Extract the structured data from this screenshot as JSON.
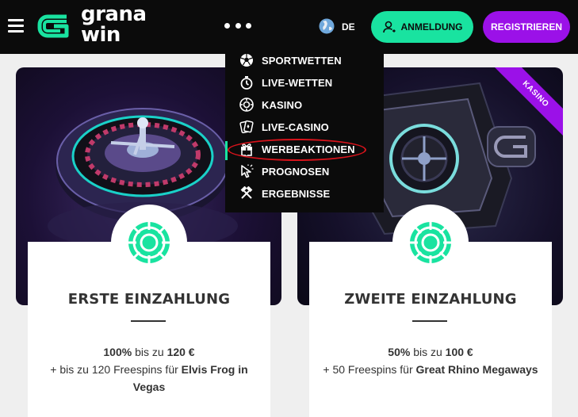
{
  "brand": {
    "name_line1": "grana",
    "name_line2": "win"
  },
  "header": {
    "language": "DE",
    "login_label": "ANMELDUNG",
    "register_label": "REGISTRIEREN"
  },
  "menu": {
    "items": [
      {
        "label": "SPORTWETTEN",
        "icon": "soccer-ball-icon"
      },
      {
        "label": "LIVE-WETTEN",
        "icon": "stopwatch-icon"
      },
      {
        "label": "KASINO",
        "icon": "casino-chip-icon"
      },
      {
        "label": "LIVE-CASINO",
        "icon": "playing-cards-icon"
      },
      {
        "label": "WERBEAKTIONEN",
        "icon": "gift-icon"
      },
      {
        "label": "PROGNOSEN",
        "icon": "cursor-icon"
      },
      {
        "label": "ERGEBNISSE",
        "icon": "crossed-hammers-icon"
      }
    ]
  },
  "promos": [
    {
      "title": "ERSTE EINZAHLUNG",
      "percent": "100%",
      "up_to": "bis zu",
      "amount": "120 €",
      "extra": "+ bis zu 120 Freespins für",
      "game": "Elvis Frog in Vegas"
    },
    {
      "title": "ZWEITE EINZAHLUNG",
      "percent": "50%",
      "up_to": "bis zu",
      "amount": "100 €",
      "extra": "+ 50 Freespins für",
      "game": "Great Rhino Megaways",
      "ribbon": "KASINO"
    }
  ],
  "colors": {
    "accent_green": "#19e3a0",
    "accent_purple": "#9b11e8",
    "highlight_red": "#d8131b"
  }
}
